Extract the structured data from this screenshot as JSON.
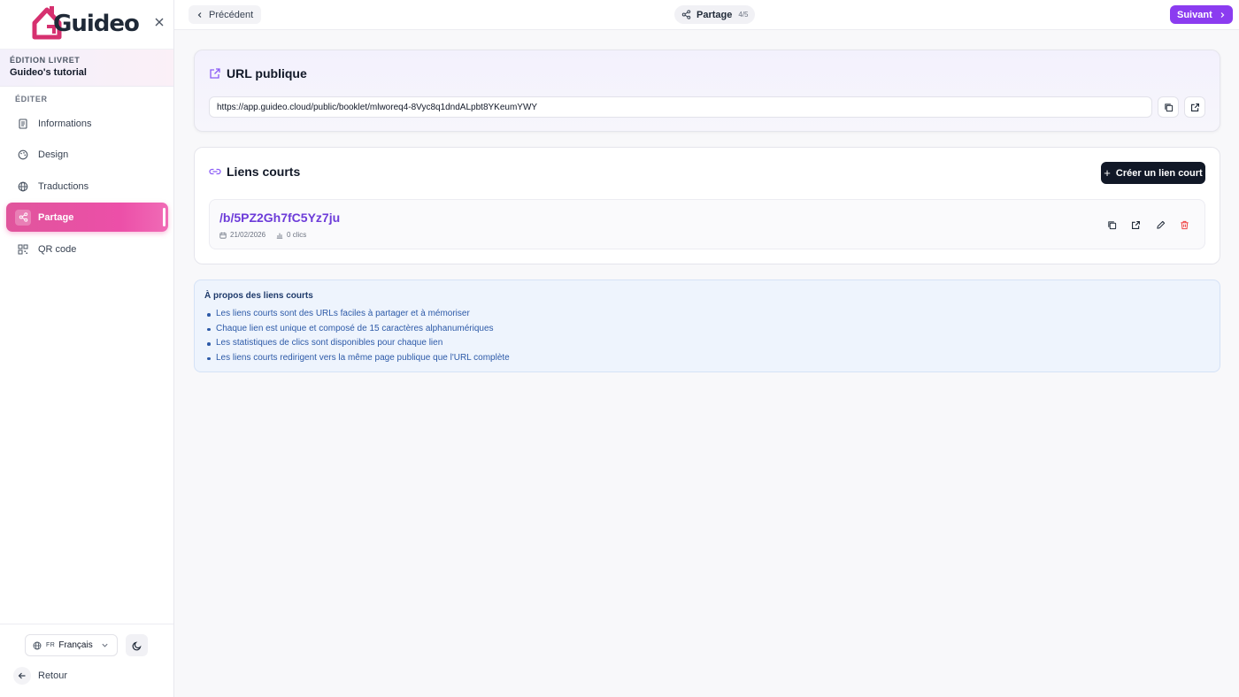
{
  "app": {
    "brand": "Guideo"
  },
  "sidebar": {
    "edition_label": "ÉDITION LIVRET",
    "booklet_name": "Guideo's tutorial",
    "section_label": "ÉDITER",
    "items": [
      {
        "label": "Informations",
        "icon": "document-icon",
        "active": false
      },
      {
        "label": "Design",
        "icon": "palette-icon",
        "active": false
      },
      {
        "label": "Traductions",
        "icon": "globe-icon",
        "active": false
      },
      {
        "label": "Partage",
        "icon": "share-icon",
        "active": true
      },
      {
        "label": "QR code",
        "icon": "qr-code-icon",
        "active": false
      }
    ],
    "language": {
      "code": "FR",
      "label": "Français"
    },
    "back_label": "Retour"
  },
  "topbar": {
    "prev_label": "Précédent",
    "step_label": "Partage",
    "step_count": "4/5",
    "next_label": "Suivant"
  },
  "public_url": {
    "title": "URL publique",
    "value": "https://app.guideo.cloud/public/booklet/mlworeq4-8Vyc8q1dndALpbt8YKeumYWY"
  },
  "short_links": {
    "title": "Liens courts",
    "create_label": "Créer un lien court",
    "items": [
      {
        "slug": "/b/5PZ2Gh7fC5Yz7ju",
        "date": "21/02/2026",
        "clicks": "0 clics"
      }
    ]
  },
  "about": {
    "title": "À propos des liens courts",
    "items": [
      "Les liens courts sont des URLs faciles à partager et à mémoriser",
      "Chaque lien est unique et composé de 15 caractères alphanumériques",
      "Les statistiques de clics sont disponibles pour chaque lien",
      "Les liens courts redirigent vers la même page publique que l'URL complète"
    ]
  },
  "colors": {
    "accent_purple": "#8b3cf0",
    "active_pink": "#ec4fa8",
    "slug_purple": "#6d3cd9",
    "delete_red": "#ef4444",
    "info_blue": "#2d5aa8"
  }
}
